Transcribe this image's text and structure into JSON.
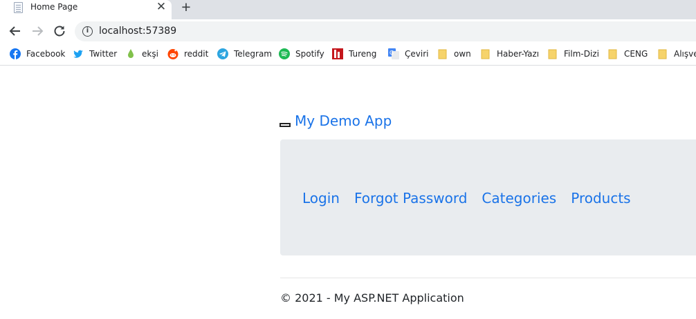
{
  "browser": {
    "tab": {
      "title": "Home Page",
      "close_glyph": "✕"
    },
    "new_tab_glyph": "+",
    "address": {
      "url": "localhost:57389",
      "info_glyph": "i"
    },
    "bookmarks": [
      {
        "label": "Facebook",
        "icon": "facebook-icon",
        "color": "#1877f2"
      },
      {
        "label": "Twitter",
        "icon": "twitter-icon",
        "color": "#1da1f2"
      },
      {
        "label": "ekşi",
        "icon": "eksi-icon",
        "color": "#81c14b"
      },
      {
        "label": "reddit",
        "icon": "reddit-icon",
        "color": "#ff4500"
      },
      {
        "label": "Telegram",
        "icon": "telegram-icon",
        "color": "#2ca5e0"
      },
      {
        "label": "Spotify",
        "icon": "spotify-icon",
        "color": "#1db954"
      },
      {
        "label": "Tureng",
        "icon": "tureng-icon",
        "color": "#c4161c"
      },
      {
        "label": "Çeviri",
        "icon": "translate-icon",
        "color": "#4285f4"
      },
      {
        "label": "own",
        "icon": "folder-icon",
        "color": "#f6d36b"
      },
      {
        "label": "Haber-Yazı",
        "icon": "folder-icon",
        "color": "#f6d36b"
      },
      {
        "label": "Film-Dizi",
        "icon": "folder-icon",
        "color": "#f6d36b"
      },
      {
        "label": "CENG",
        "icon": "folder-icon",
        "color": "#f6d36b"
      },
      {
        "label": "Alışveri",
        "icon": "folder-icon",
        "color": "#f6d36b"
      }
    ]
  },
  "page": {
    "brand": "My Demo App",
    "nav": [
      "Login",
      "Forgot Password",
      "Categories",
      "Products"
    ],
    "footer": "© 2021 - My ASP.NET Application"
  },
  "colors": {
    "link": "#1a73e8",
    "jumbotron_bg": "#e9ecef",
    "tabstrip_bg": "#dee1e6"
  }
}
